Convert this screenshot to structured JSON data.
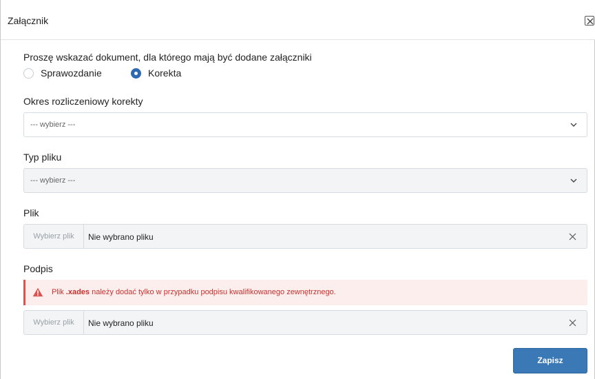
{
  "dialog": {
    "title": "Załącznik",
    "close_icon": "close-icon"
  },
  "form": {
    "question": "Proszę wskazać dokument, dla którego mają być dodane załączniki",
    "document_options": [
      {
        "label": "Sprawozdanie",
        "checked": false
      },
      {
        "label": "Korekta",
        "checked": true
      }
    ],
    "period": {
      "label": "Okres rozliczeniowy korekty",
      "value": "--- wybierz ---"
    },
    "file_type": {
      "label": "Typ pliku",
      "value": "--- wybierz ---"
    },
    "file": {
      "label": "Plik",
      "button": "Wybierz plik",
      "status": "Nie wybrano pliku"
    },
    "signature": {
      "label": "Podpis",
      "alert_prefix": "Plik ",
      "alert_bold": ".xades",
      "alert_suffix": " należy dodać tylko w przypadku podpisu kwalifikowanego zewnętrznego.",
      "button": "Wybierz plik",
      "status": "Nie wybrano pliku"
    },
    "save_label": "Zapisz"
  },
  "colors": {
    "accent": "#3a78b6",
    "radio_checked": "#2e6ab1",
    "alert_text": "#c9302c",
    "alert_bg": "#fdeeee"
  }
}
